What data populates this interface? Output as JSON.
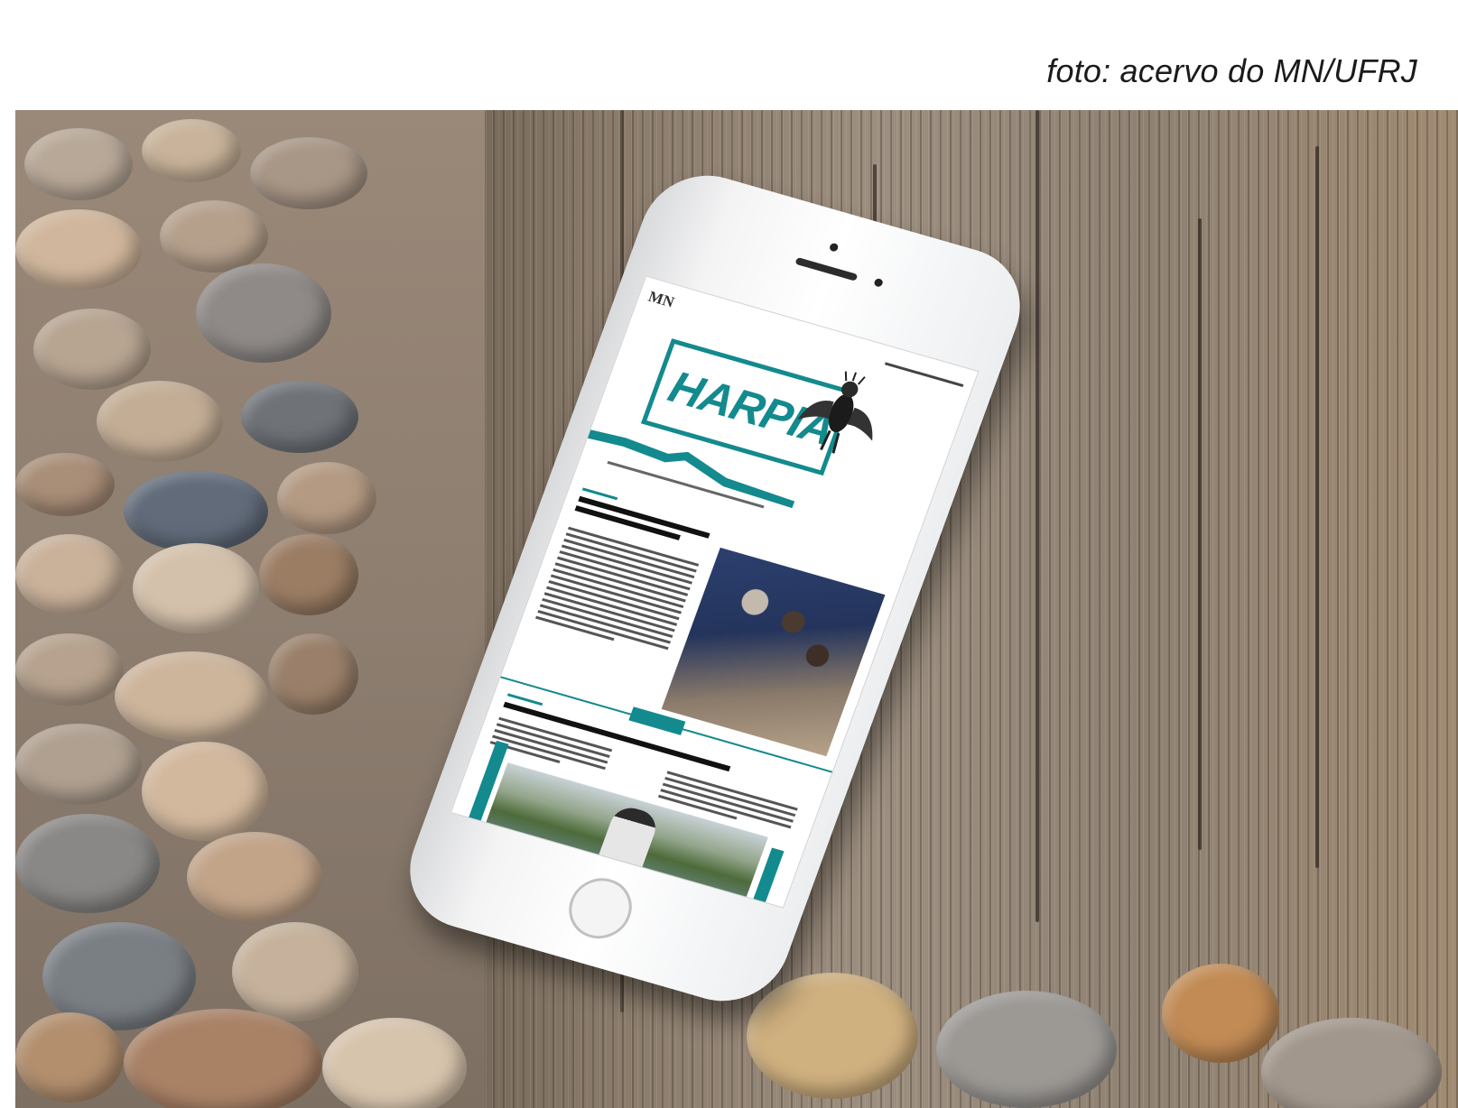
{
  "caption": "foto: acervo do MN/UFRJ",
  "newsletter": {
    "logo_text": "HARPIA",
    "header_logo": "MN",
    "accent_color": "#138a8e"
  },
  "icons": {
    "bird": "harpy-eagle-illustration"
  }
}
